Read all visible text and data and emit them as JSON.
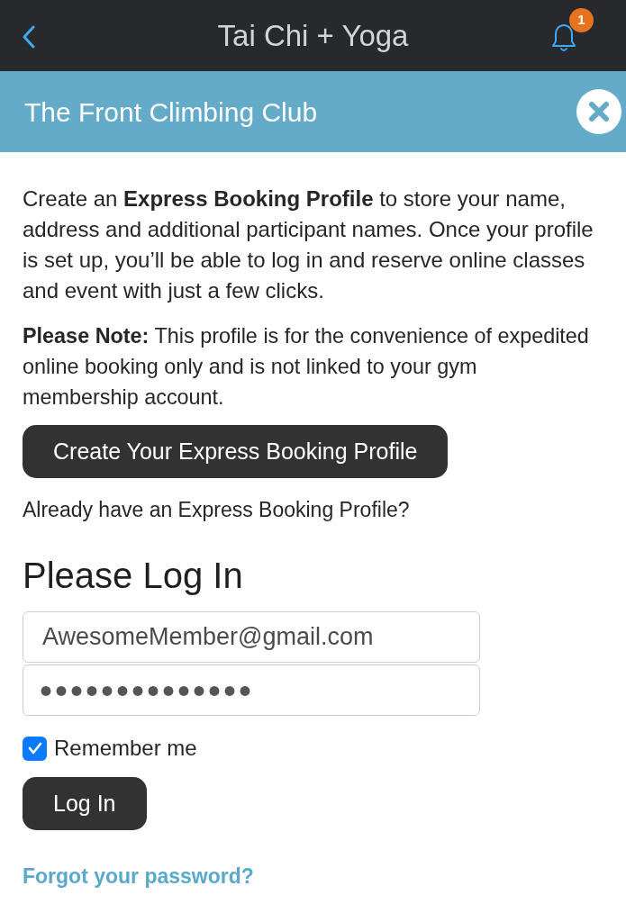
{
  "header": {
    "title": "Tai Chi + Yoga",
    "notification_count": "1"
  },
  "banner": {
    "title": "The Front Climbing Club"
  },
  "intro": "Create an **Express Booking Profile** to store your name, address and additional participant names. Once your profile is set up, you’ll be able to log in and reserve online classes and event with just a few clicks.",
  "note": "**Please Note:** This profile is for the convenience of expedited online booking only and is not linked to your gym membership account.",
  "create_button": "Create Your Express Booking Profile",
  "existing_prompt": "Already have an Express Booking Profile?",
  "login": {
    "heading": "Please Log In",
    "email": {
      "value": "AwesomeMember@gmail.com"
    },
    "password": {
      "value": "••••••••••••••"
    },
    "remember_me": {
      "label": "Remember me",
      "checked": true
    },
    "submit": "Log In",
    "forgot_link": "Forgot your password?"
  }
}
